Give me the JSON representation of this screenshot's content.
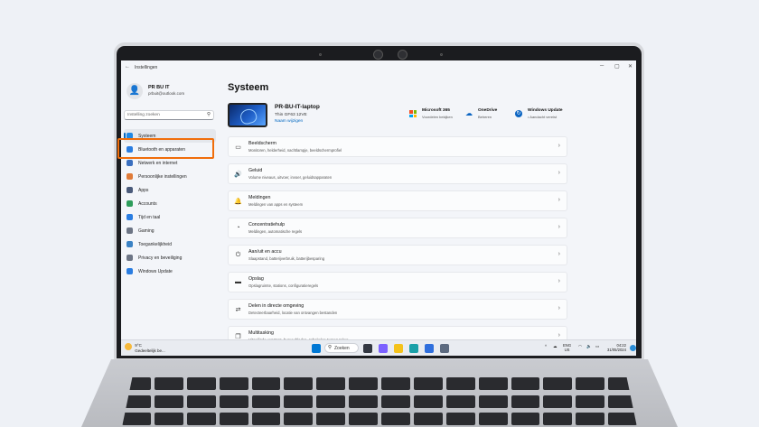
{
  "window": {
    "title": "Instellingen",
    "back_glyph": "←",
    "minimize_glyph": "─",
    "maximize_glyph": "▢",
    "close_glyph": "✕"
  },
  "profile": {
    "name": "PR BU IT",
    "email": "prbuit@outlook.com",
    "avatar_glyph": "👤"
  },
  "search": {
    "placeholder": "Instelling zoeken",
    "icon": "search-icon"
  },
  "sidebar": {
    "items": [
      {
        "label": "Systeem",
        "icon": "monitor-icon",
        "color": "#1e88e5",
        "active": true
      },
      {
        "label": "Bluetooth en apparaten",
        "icon": "bluetooth-icon",
        "color": "#2a7de1"
      },
      {
        "label": "Netwerk en internet",
        "icon": "wifi-icon",
        "color": "#3a6fbf"
      },
      {
        "label": "Persoonlijke instellingen",
        "icon": "brush-icon",
        "color": "#e07b39"
      },
      {
        "label": "Apps",
        "icon": "apps-icon",
        "color": "#4a5a7a"
      },
      {
        "label": "Accounts",
        "icon": "person-icon",
        "color": "#2e9d5b"
      },
      {
        "label": "Tijd en taal",
        "icon": "globe-icon",
        "color": "#2a7de1"
      },
      {
        "label": "Gaming",
        "icon": "controller-icon",
        "color": "#6d7585"
      },
      {
        "label": "Toegankelijkheid",
        "icon": "accessibility-icon",
        "color": "#3b82c4"
      },
      {
        "label": "Privacy en beveiliging",
        "icon": "shield-icon",
        "color": "#6d7585"
      },
      {
        "label": "Windows Update",
        "icon": "update-icon",
        "color": "#2a7de1"
      }
    ]
  },
  "highlight_color": "#f06d0a",
  "main": {
    "title": "Systeem",
    "device": {
      "name": "PR-BU-IT-laptop",
      "model": "Thin GF63 12VE",
      "rename": "Naam wijzigen"
    },
    "status": [
      {
        "title": "Microsoft 365",
        "sub": "Voordelen bekijken",
        "icon": "microsoft-icon"
      },
      {
        "title": "OneDrive",
        "sub": "Beheren",
        "icon": "cloud-icon"
      },
      {
        "title": "Windows Update",
        "sub": "• Aandacht vereist",
        "icon": "update-icon"
      }
    ],
    "cards": [
      {
        "title": "Beeldscherm",
        "sub": "Monitoren, helderheid, nachtlampje, beeldschermprofiel",
        "icon": "display-icon",
        "glyph": "▭"
      },
      {
        "title": "Geluid",
        "sub": "Volume niveaus, uitvoer, invoer, geluidsapparaten",
        "icon": "speaker-icon",
        "glyph": "🔊"
      },
      {
        "title": "Meldingen",
        "sub": "Meldingen van apps en systeem",
        "icon": "bell-icon",
        "glyph": "🔔"
      },
      {
        "title": "Concentratiehulp",
        "sub": "Meldingen, automatische regels",
        "icon": "focus-icon",
        "glyph": "◔"
      },
      {
        "title": "Aan/uit en accu",
        "sub": "Slaapstand, batterijverbruik, batterijbesparing",
        "icon": "power-icon",
        "glyph": "⏻"
      },
      {
        "title": "Opslag",
        "sub": "Opslagruimte, stations, configuratieregels",
        "icon": "storage-icon",
        "glyph": "▬"
      },
      {
        "title": "Delen in directe omgeving",
        "sub": "Detecteerbaarheid, locatie van ontvangen bestanden",
        "icon": "share-icon",
        "glyph": "⇄"
      },
      {
        "title": "Multitasking",
        "sub": "Uitgelijnde vensters, bureaubladen, schakelen tussen taken",
        "icon": "multitask-icon",
        "glyph": "❐"
      }
    ],
    "chevron": "›"
  },
  "taskbar": {
    "weather_temp": "9°C",
    "weather_desc": "Gedeeltelijk be...",
    "search_label": "Zoeken",
    "apps": [
      {
        "icon": "windows-start-icon",
        "color": "#0078d4"
      },
      {
        "icon": "task-view-icon",
        "color": "#333842"
      },
      {
        "icon": "chat-icon",
        "color": "#7b61ff"
      },
      {
        "icon": "file-explorer-icon",
        "color": "#f4c21b"
      },
      {
        "icon": "edge-icon",
        "color": "#1aa0a8"
      },
      {
        "icon": "store-icon",
        "color": "#2f6fdd"
      },
      {
        "icon": "settings-icon",
        "color": "#5d6b80"
      }
    ],
    "tray_chevron": "^",
    "lang_top": "ENG",
    "lang_bottom": "US",
    "time": "04:22",
    "date": "31/05/2024"
  }
}
